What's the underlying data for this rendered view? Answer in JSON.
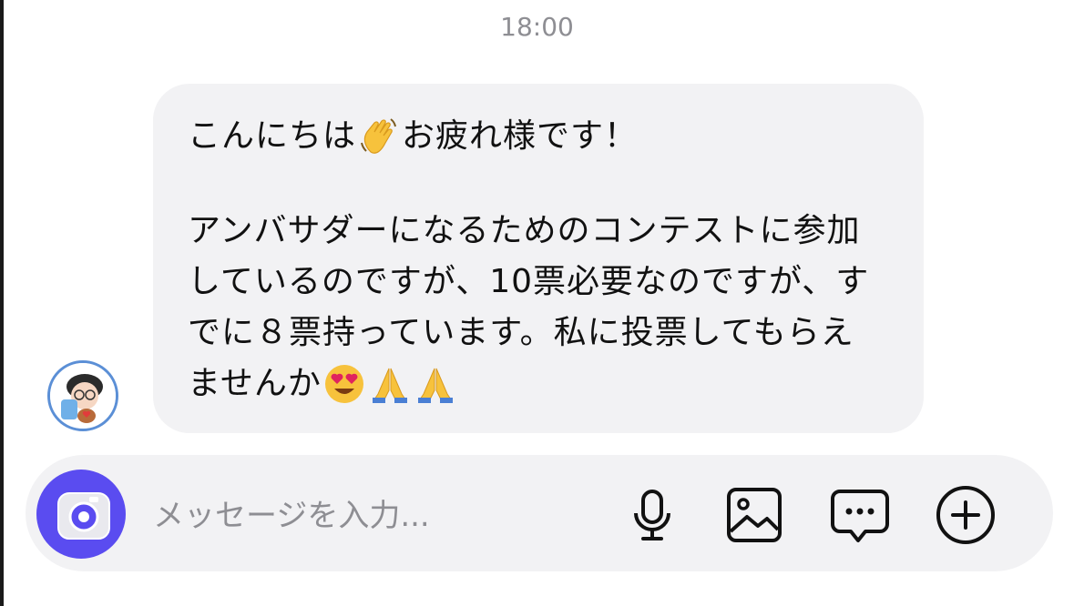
{
  "chat": {
    "timestamp": "18:00",
    "message": {
      "greeting_before": "こんにちは",
      "greeting_emoji": "waving-hand-emoji",
      "greeting_after": "お疲れ様です！",
      "line_2": "アンバサダーになるためのコンテストに参加",
      "line_3": "しているのですが、10票必要なのですが、す",
      "line_4": "でに８票持っています。私に投票してもらえ",
      "line_5": "ませんか",
      "line_5_emojis": [
        "heart-eyes-emoji",
        "folded-hands-emoji",
        "folded-hands-emoji"
      ]
    },
    "sender_avatar": "avatar"
  },
  "composer": {
    "placeholder": "メッセージを入力...",
    "value": "",
    "camera_icon": "camera-icon",
    "tools": [
      "microphone-icon",
      "image-icon",
      "sticker-icon",
      "plus-circle-icon"
    ]
  },
  "colors": {
    "bubble_bg": "#f2f2f4",
    "timestamp": "#8e8e93",
    "accent": "#5a4cf0",
    "avatar_ring": "#5b8fd6"
  }
}
